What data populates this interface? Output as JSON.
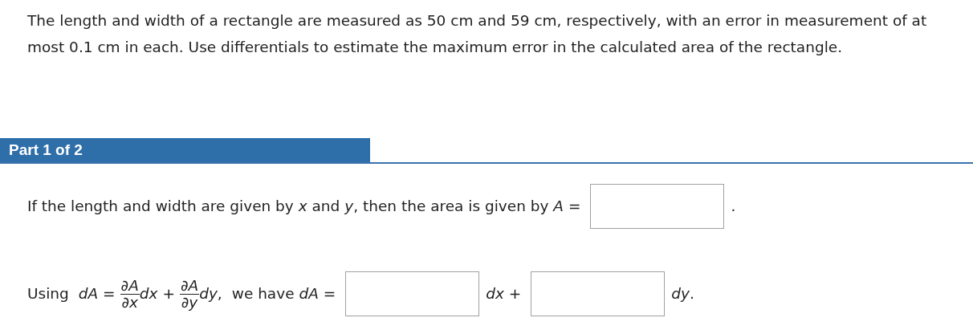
{
  "problem": "The length and width of a rectangle are measured as 50 cm and 59 cm, respectively, with an error in measurement of at most 0.1 cm in each. Use differentials to estimate the maximum error in the calculated area of the rectangle.",
  "part": {
    "title": "Part 1 of 2"
  },
  "area_question": {
    "text": "If the length and width are given by *x* and *y*, then the area is given by *A* =",
    "suffix": "."
  },
  "differential_question": {
    "lead": "Using",
    "lhs": "*dA* =",
    "terms": [
      {
        "numerator": "∂*A*",
        "denominator": "∂*x*",
        "differential": "*dx* +"
      },
      {
        "numerator": "∂*A*",
        "denominator": "∂*y*",
        "differential": "*dy*,"
      }
    ],
    "middle": "we have *dA* =",
    "answers": [
      {
        "suffix": "*dx* +"
      },
      {
        "suffix": "*dy*."
      }
    ]
  }
}
